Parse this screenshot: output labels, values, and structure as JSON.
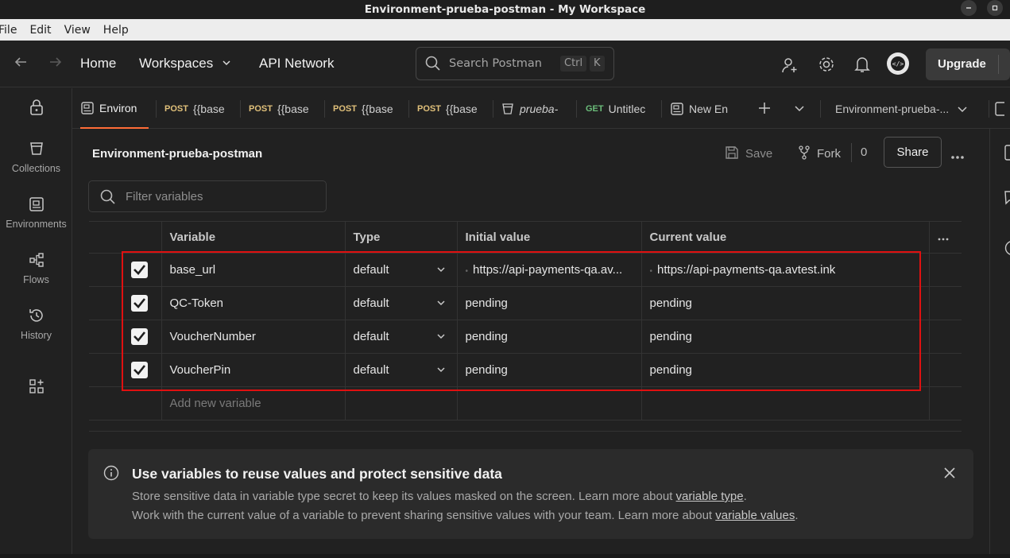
{
  "window": {
    "title": "Environment-prueba-postman - My Workspace"
  },
  "menu": [
    "File",
    "Edit",
    "View",
    "Help"
  ],
  "header": {
    "home": "Home",
    "workspaces": "Workspaces",
    "api_network": "API Network",
    "search_placeholder": "Search Postman",
    "kbd_ctrl": "Ctrl",
    "kbd_k": "K",
    "upgrade": "Upgrade"
  },
  "sidebar": {
    "items": [
      {
        "label": "Collections",
        "icon": "collections-icon"
      },
      {
        "label": "Environments",
        "icon": "environments-icon"
      },
      {
        "label": "Flows",
        "icon": "flows-icon"
      },
      {
        "label": "History",
        "icon": "history-icon"
      }
    ]
  },
  "tabs": [
    {
      "method": "",
      "label": "Environ"
    },
    {
      "method": "POST",
      "label": "{{base"
    },
    {
      "method": "POST",
      "label": "{{base"
    },
    {
      "method": "POST",
      "label": "{{base"
    },
    {
      "method": "POST",
      "label": "{{base"
    },
    {
      "method": "",
      "label": "prueba-"
    },
    {
      "method": "GET",
      "label": "Untitlec"
    },
    {
      "method": "",
      "label": "New En"
    }
  ],
  "env_selector": "Environment-prueba-...",
  "environment": {
    "name": "Environment-prueba-postman",
    "save": "Save",
    "fork": "Fork",
    "fork_count": "0",
    "share": "Share",
    "filter_placeholder": "Filter variables"
  },
  "table": {
    "headers": {
      "variable": "Variable",
      "type": "Type",
      "initial": "Initial value",
      "current": "Current value"
    },
    "rows": [
      {
        "variable": "base_url",
        "type": "default",
        "initial": "https://api-payments-qa.av...",
        "current": "https://api-payments-qa.avtest.ink",
        "checked": true
      },
      {
        "variable": "QC-Token",
        "type": "default",
        "initial": "pending",
        "current": "pending",
        "checked": true
      },
      {
        "variable": "VoucherNumber",
        "type": "default",
        "initial": "pending",
        "current": "pending",
        "checked": true
      },
      {
        "variable": "VoucherPin",
        "type": "default",
        "initial": "pending",
        "current": "pending",
        "checked": true
      }
    ],
    "add_new": "Add new variable"
  },
  "info": {
    "title": "Use variables to reuse values and protect sensitive data",
    "line1_text": "Store sensitive data in variable type secret to keep its values masked on the screen. Learn more about ",
    "line1_link": "variable type",
    "line2_text": "Work with the current value of a variable to prevent sharing sensitive values with your team. Learn more about ",
    "line2_link": "variable values"
  },
  "colors": {
    "accent": "#ff6c37",
    "highlight": "#e01010",
    "post": "#e0c07a",
    "get": "#6bbd7a"
  }
}
